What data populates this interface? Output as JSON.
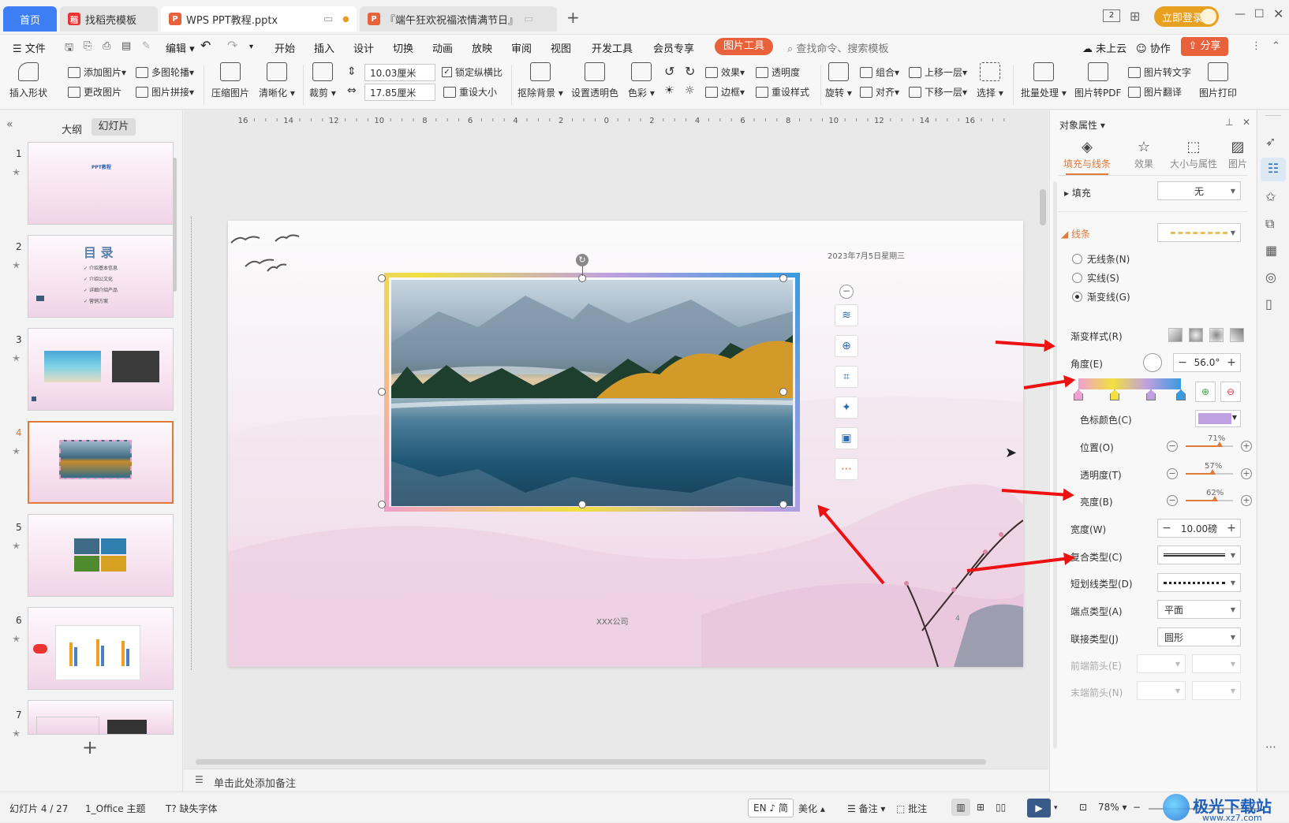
{
  "titlebar": {
    "tabs": [
      {
        "label": "首页",
        "active": false
      },
      {
        "label": "找稻壳模板",
        "active": false
      },
      {
        "label": "WPS PPT教程.pptx",
        "active": true
      },
      {
        "label": "『端午狂欢祝福浓情满节日』",
        "active": false
      }
    ],
    "login_label": "立即登录",
    "page_badge": "2"
  },
  "menubar": {
    "file": "文件",
    "edit": "编辑",
    "items": [
      "开始",
      "插入",
      "设计",
      "切换",
      "动画",
      "放映",
      "审阅",
      "视图",
      "开发工具",
      "会员专享"
    ],
    "active_tool": "图片工具",
    "search_placeholder": "查找命令、搜索模板",
    "cloud": "未上云",
    "collab": "协作",
    "share": "分享"
  },
  "ribbon": {
    "insert_shape": "插入形状",
    "add_picture": "添加图片",
    "change_picture": "更改图片",
    "multi_outline": "多图轮播",
    "picture_stitch": "图片拼接",
    "compress": "压缩图片",
    "clarity": "清晰化",
    "crop": "裁剪",
    "width_value": "10.03厘米",
    "height_value": "17.85厘米",
    "lock_ratio": "锁定纵横比",
    "reset_size": "重设大小",
    "remove_bg": "抠除背景",
    "set_transparent": "设置透明色",
    "color": "色彩",
    "effect": "效果",
    "transparency": "透明度",
    "border": "边框",
    "reset_style": "重设样式",
    "rotate": "旋转",
    "group": "组合",
    "align": "对齐",
    "bring_forward": "上移一层",
    "send_backward": "下移一层",
    "select": "选择",
    "batch": "批量处理",
    "to_pdf": "图片转PDF",
    "to_text": "图片转文字",
    "translate": "图片翻译",
    "print": "图片打印"
  },
  "leftpanel": {
    "tab_outline": "大纲",
    "tab_slides": "幻灯片",
    "slides": [
      {
        "num": "1",
        "text": "PPT教程"
      },
      {
        "num": "2",
        "title": "目 录",
        "items": [
          "介绍基本信息",
          "介绍公文化",
          "详细介绍产品",
          "营销方案"
        ]
      },
      {
        "num": "3",
        "text": ""
      },
      {
        "num": "4",
        "text": ""
      },
      {
        "num": "5",
        "text": ""
      },
      {
        "num": "6",
        "text": ""
      },
      {
        "num": "7",
        "text": ""
      }
    ],
    "add_label": "+"
  },
  "slide": {
    "date": "2023年7月5日星期三",
    "company": "XXX公司",
    "page_num": "4"
  },
  "notes_placeholder": "单击此处添加备注",
  "rightpanel": {
    "title": "对象属性",
    "tabs": [
      "填充与线条",
      "效果",
      "大小与属性",
      "图片"
    ],
    "fill_label": "填充",
    "fill_value": "无",
    "line_label": "线条",
    "radio_none": "无线条(N)",
    "radio_solid": "实线(S)",
    "radio_gradient": "渐变线(G)",
    "gradient_style": "渐变样式(R)",
    "angle_label": "角度(E)",
    "angle_value": "56.0°",
    "stop_color": "色标颜色(C)",
    "position_label": "位置(O)",
    "position_pct": "71%",
    "position_value": 0.71,
    "transparency_label": "透明度(T)",
    "transparency_pct": "57%",
    "transparency_value": 0.57,
    "brightness_label": "亮度(B)",
    "brightness_pct": "62%",
    "brightness_value": 0.62,
    "width_label": "宽度(W)",
    "width_value": "10.00磅",
    "compound_label": "复合类型(C)",
    "dash_label": "短划线类型(D)",
    "cap_label": "端点类型(A)",
    "cap_value": "平面",
    "join_label": "联接类型(J)",
    "join_value": "圆形",
    "begin_arrow": "前端箭头(E)",
    "end_arrow": "末端箭头(N)"
  },
  "statusbar": {
    "slide_info": "幻灯片 4 / 27",
    "theme": "1_Office 主题",
    "missing_font": "缺失字体",
    "ime": "EN ♪ 简",
    "beautify": "美化",
    "notes": "备注",
    "comment": "批注",
    "zoom": "78%"
  },
  "watermark": {
    "brand": "极光下载站",
    "url": "www.xz7.com"
  },
  "colors": {
    "accent": "#e8613a",
    "login": "#e8a020",
    "selected_border": "#e07a3a",
    "arrow": "#e11111"
  }
}
